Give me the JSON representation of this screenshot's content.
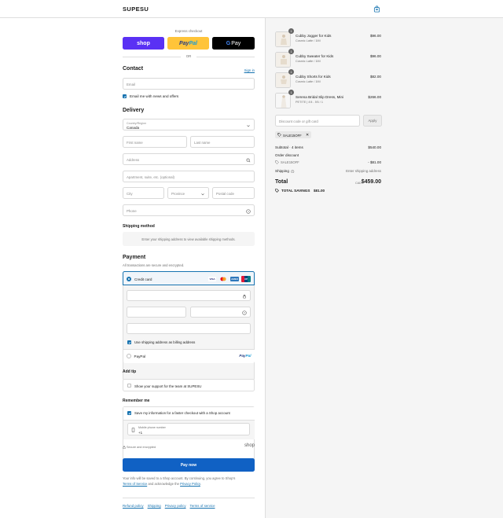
{
  "header": {
    "brand": "SUPESU",
    "cart_icon": "shopping-bag-icon"
  },
  "express": {
    "title": "Express checkout",
    "shop_label": "shop",
    "paypal_label_1": "Pay",
    "paypal_label_2": "Pal",
    "gpay_g": "G",
    "gpay_label": "Pay",
    "or_label": "OR"
  },
  "contact": {
    "heading": "Contact",
    "sign_in": "Sign in",
    "email_placeholder": "Email",
    "news_label": "Email me with news and offers"
  },
  "delivery": {
    "heading": "Delivery",
    "country_label": "Country/Region",
    "country_value": "Canada",
    "first_name": "First name",
    "last_name": "Last name",
    "address": "Address",
    "apartment": "Apartment, suite, etc. (optional)",
    "city": "City",
    "province": "Province",
    "postal": "Postal code",
    "phone": "Phone"
  },
  "shipping_method": {
    "heading": "Shipping method",
    "message": "Enter your shipping address to view available shipping methods."
  },
  "payment": {
    "heading": "Payment",
    "subtitle": "All transactions are secure and encrypted.",
    "credit_card_label": "Credit card",
    "brands": [
      "VISA",
      "MC",
      "AMEX",
      "UP"
    ],
    "billing_label": "Use shipping address as billing address",
    "paypal_label": "PayPal",
    "paypal_logo_1": "Pay",
    "paypal_logo_2": "Pal"
  },
  "tip": {
    "heading": "Add tip",
    "label": "Show your support for the team at SUPESU"
  },
  "remember": {
    "heading": "Remember me",
    "save_label": "Save my information for a faster checkout with a Shop account",
    "phone_label": "Mobile phone number",
    "phone_value": "+1",
    "secure_label": "Secure and encrypted",
    "shop_logo": "shop"
  },
  "pay_now": "Pay now",
  "legal": {
    "line1": "Your info will be saved to a Shop account. By continuing, you agree to Shop's",
    "terms": "Terms of Service",
    "and_text": " and acknowledge the ",
    "privacy": "Privacy Policy",
    "period": "."
  },
  "footer": {
    "links": [
      "Refund policy",
      "Shipping",
      "Privacy policy",
      "Terms of service"
    ]
  },
  "summary": {
    "items": [
      {
        "qty": "1",
        "name": "Cubby Jogger for Kids",
        "variant": "Cosmic Latte / 1IM",
        "price": "$96.00"
      },
      {
        "qty": "1",
        "name": "Cubby Sweater for Kids",
        "variant": "Cosmic Latte / 1IM",
        "price": "$96.00"
      },
      {
        "qty": "1",
        "name": "Cubby Shorts for Kids",
        "variant": "Cosmic Latte / 1IM",
        "price": "$82.00"
      },
      {
        "qty": "1",
        "name": "Serena Bridal Slip Dress, Mini",
        "variant": "PETITE | 4'8 - 5'6 / 1",
        "price": "$266.00"
      }
    ],
    "discount_placeholder": "Discount code or gift card",
    "apply_label": "Apply",
    "applied_code": "SALE15OFF",
    "subtotal_label": "Subtotal · 4 items",
    "subtotal_value": "$540.00",
    "order_discount_label": "Order discount",
    "order_discount_code": "SALE15OFF",
    "order_discount_value": "- $81.00",
    "shipping_label": "Shipping",
    "shipping_value": "Enter shipping address",
    "total_label": "Total",
    "currency": "CAD",
    "total_value": "$459.00",
    "savings_label": "TOTAL SAVINGS",
    "savings_value": "$81.00"
  }
}
